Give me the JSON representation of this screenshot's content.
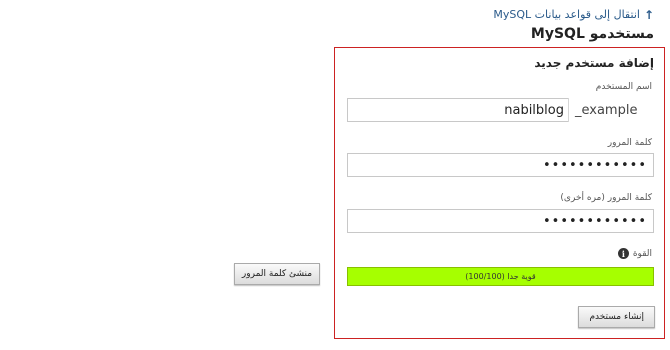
{
  "header": {
    "back_link": "انتقال إلى قواعد بيانات MySQL",
    "back_icon": "arrow-up-icon",
    "title": "مستخدمو MySQL"
  },
  "form": {
    "title": "إضافة مستخدم جديد",
    "username_label": "اسم المستخدم",
    "username_prefix": "_example",
    "username_value": "nabilblog",
    "password_label": "كلمة المرور",
    "password_value": "••••••••••••",
    "password_again_label": "كلمة المرور (مره أخرى)",
    "password_again_value": "••••••••••••",
    "strength_label": "القوة",
    "strength_icon": "info-icon",
    "strength_text": "قوية جدا (100/100)",
    "strength_fraction": 1.0,
    "strength_color": "#a6ff00",
    "create_button": "إنشاء مستخدم"
  },
  "generator_button": "منشئ كلمة المرور"
}
